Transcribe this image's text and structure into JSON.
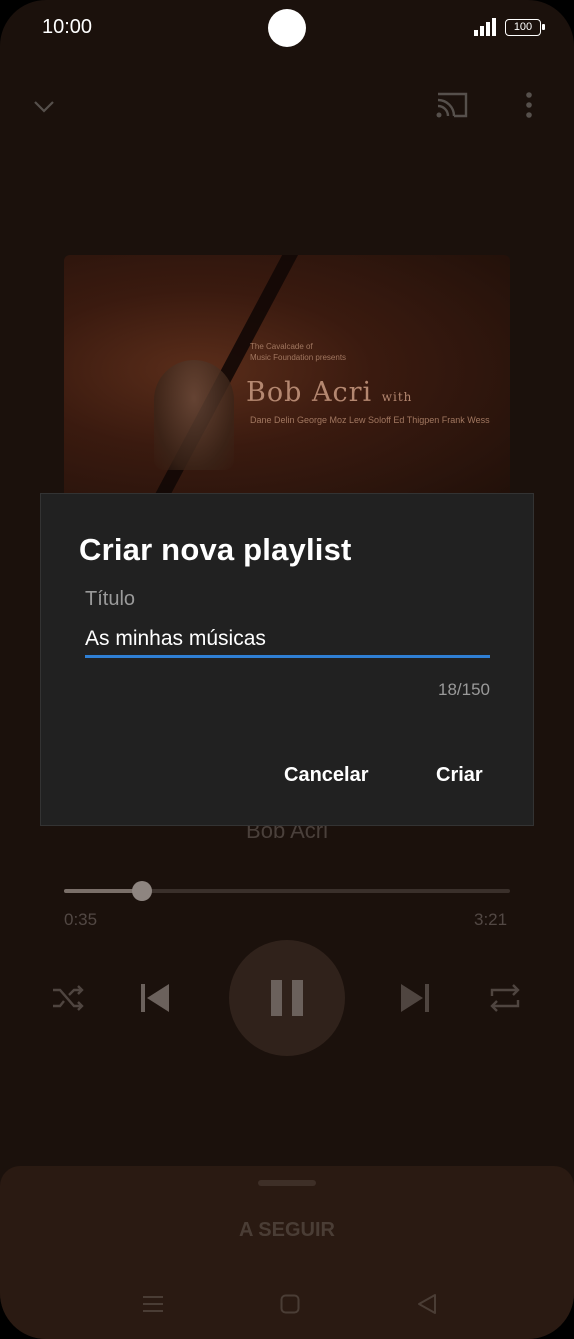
{
  "status_bar": {
    "time": "10:00",
    "battery": "100"
  },
  "album": {
    "presents_line1": "The Cavalcade of",
    "presents_line2": "Music Foundation presents",
    "artist_script": "Bob Acri",
    "with": "with",
    "credits": "Dane Delin George Moz Lew Soloff  Ed Thigpen Frank Wess"
  },
  "player": {
    "artist": "Bob Acri",
    "elapsed": "0:35",
    "total": "3:21",
    "progress_fraction": 0.174
  },
  "sheet": {
    "up_next": "A SEGUIR"
  },
  "dialog": {
    "title": "Criar nova playlist",
    "field_label": "Título",
    "field_value": "As minhas músicas",
    "counter": "18/150",
    "cancel": "Cancelar",
    "create": "Criar"
  },
  "colors": {
    "accent": "#2f7fd4",
    "dialog_bg": "#212121"
  }
}
